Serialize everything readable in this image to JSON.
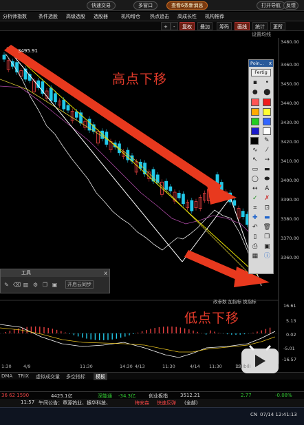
{
  "top_buttons": {
    "quick_trade": "快速交易",
    "multi_window": "多窗口",
    "news_tip": "查看6条新消息",
    "open_nav": "打开导航",
    "feedback": "反馈"
  },
  "menu": [
    "分析师指数",
    "条件选股",
    "高级选股",
    "选股器",
    "机构增仓",
    "热点追击",
    "高成长性",
    "机构推荐"
  ],
  "toolbar": {
    "plus": "+",
    "minus": "-",
    "restore_label": "复权",
    "overlay_label": "叠加",
    "chip_label": "筹码",
    "draw_label": "画线",
    "stats_label": "统计",
    "more_label": "更所"
  },
  "settings_label": "设置均线",
  "high_price_label": "3495.91",
  "y_axis": [
    "3480.00",
    "3460.00",
    "3450.00",
    "3440.00",
    "3430.00",
    "3420.00",
    "3410.00",
    "3400.00",
    "3390.00",
    "3380.00",
    "3370.00",
    "3360.00"
  ],
  "annotations": {
    "high": "高点下移",
    "low": "低点下移"
  },
  "palette": {
    "title": "Poin...",
    "close": "x",
    "done_button": "Fertig",
    "colors": [
      "#ff5555",
      "#ee1c1c",
      "#ffaa00",
      "#ffff33",
      "#22cc22",
      "#3366ff",
      "#1a1acc",
      "#ffffff",
      "#000000"
    ]
  },
  "tool_window": {
    "title": "工具",
    "close": "x",
    "export_label": "开启云同步"
  },
  "indicator_header": {
    "settings": "改参数",
    "add": "加指标",
    "switch": "换指标"
  },
  "indicator_axis": [
    "16.61",
    "5.13",
    "0.02",
    "-5.01",
    "-16.57"
  ],
  "x_axis": [
    "1:30",
    "4/9",
    "11:30",
    "14:30",
    "4/13",
    "11:30",
    "4/14",
    "11:30",
    "13:30"
  ],
  "tabs": [
    "DMA",
    "TRIX",
    "虚拟成交量",
    "多空指标",
    "模板"
  ],
  "ticker": {
    "left": "36 62 1590",
    "turnover": "4425.1亿",
    "sz_index_label": "深能通",
    "sz_index_change": "-34.3亿",
    "chinext_label": "创业板指",
    "chinext_value": "3512.21",
    "change_val": "2.77",
    "change_pct": "-0.08%"
  },
  "news": {
    "time": "11:57",
    "headline": "午间公告：章源钨业、振华科技、",
    "tag1": "梅安森",
    "tag2": "快速反弹",
    "tag3": "(全部)"
  },
  "taskbar": {
    "lang": "CN",
    "date_time": "07/14 12:41:13"
  },
  "watermark": "bilibili"
}
